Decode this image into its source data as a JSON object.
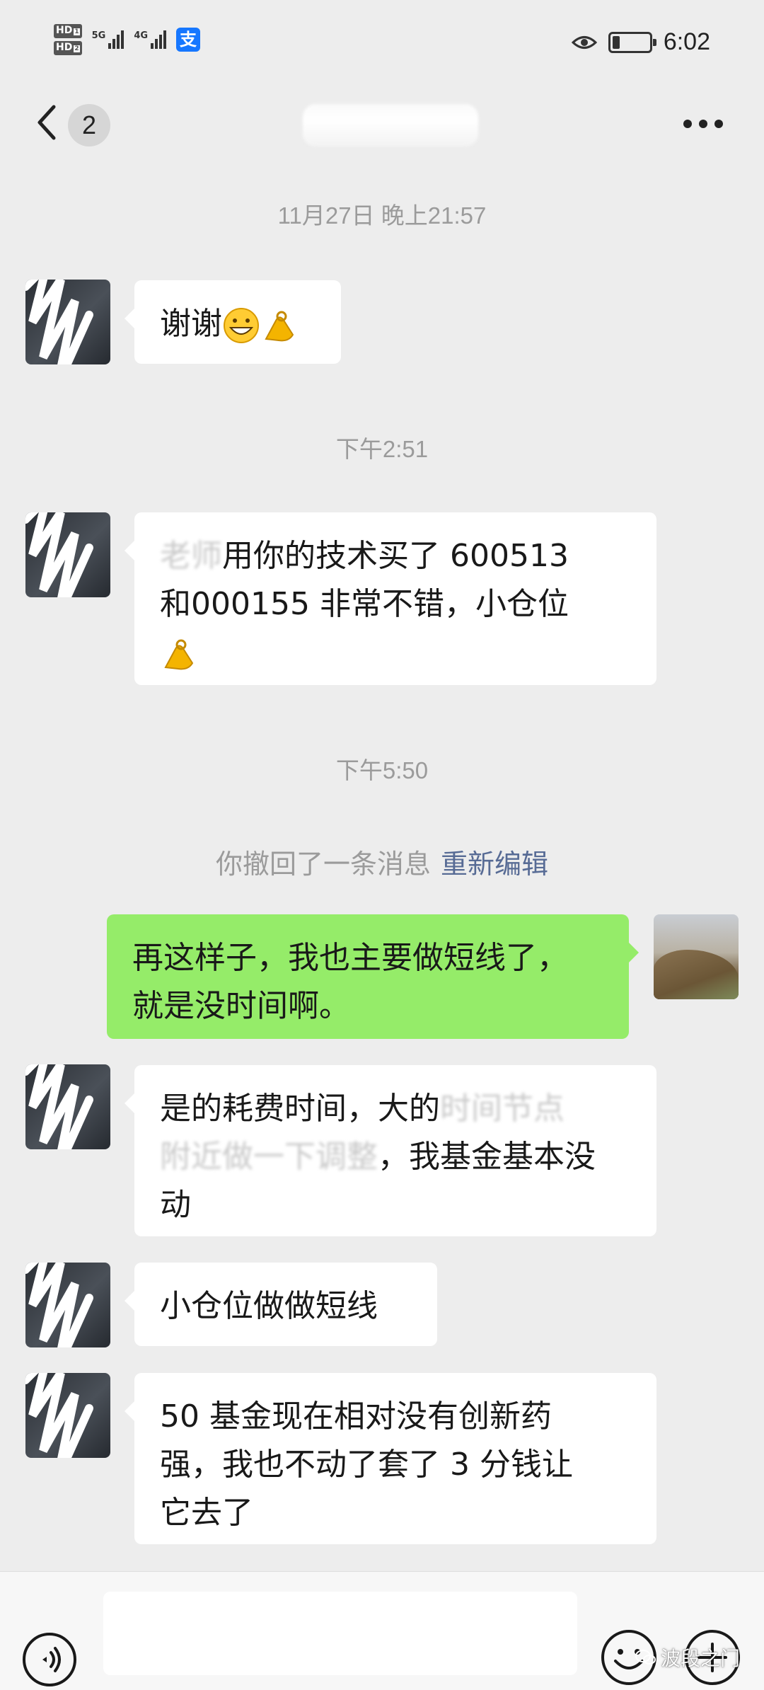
{
  "status_bar": {
    "sim1": "HD",
    "sim1_num": "1",
    "sim2": "HD",
    "sim2_num": "2",
    "net1": "5G",
    "net2": "4G",
    "alipay_glyph": "支",
    "time": "6:02",
    "battery_level": 0.2
  },
  "header": {
    "unread_count": "2",
    "icons": [
      "chevron-left-icon",
      "more-icon"
    ]
  },
  "messages": [
    {
      "type": "timestamp",
      "text": "11月27日 晚上21:57"
    },
    {
      "type": "incoming",
      "text": "谢谢",
      "emojis": [
        "grin-emoji",
        "ok-hand-emoji"
      ]
    },
    {
      "type": "timestamp",
      "text": "下午2:51"
    },
    {
      "type": "incoming",
      "redacted_prefix": "老师",
      "text": "用你的技术买了 600513",
      "text2": "和000155 非常不错，小仓位",
      "emojis": [
        "ok-hand-emoji"
      ]
    },
    {
      "type": "timestamp",
      "text": "下午5:50"
    },
    {
      "type": "recall",
      "text": "你撤回了一条消息",
      "link": "重新编辑"
    },
    {
      "type": "outgoing",
      "text": "再这样子，我也主要做短线了，",
      "text2": "就是没时间啊。"
    },
    {
      "type": "incoming",
      "text": "是的耗费时间，大的",
      "redacted_mid": "时间节点",
      "redacted_line2": "附近做一下调整",
      "text2": "，我基金基本没",
      "text3": "动"
    },
    {
      "type": "incoming",
      "text": "小仓位做做短线"
    },
    {
      "type": "incoming",
      "text": "50 基金现在相对没有创新药",
      "text2": "强，我也不动了套了 3 分钱让",
      "text3": "它去了"
    }
  ],
  "watermark": "波段之门",
  "colors": {
    "background": "#ededed",
    "incoming_bubble": "#ffffff",
    "outgoing_bubble": "#95ec69",
    "timestamp": "#9b9b9b",
    "link": "#576b95"
  }
}
